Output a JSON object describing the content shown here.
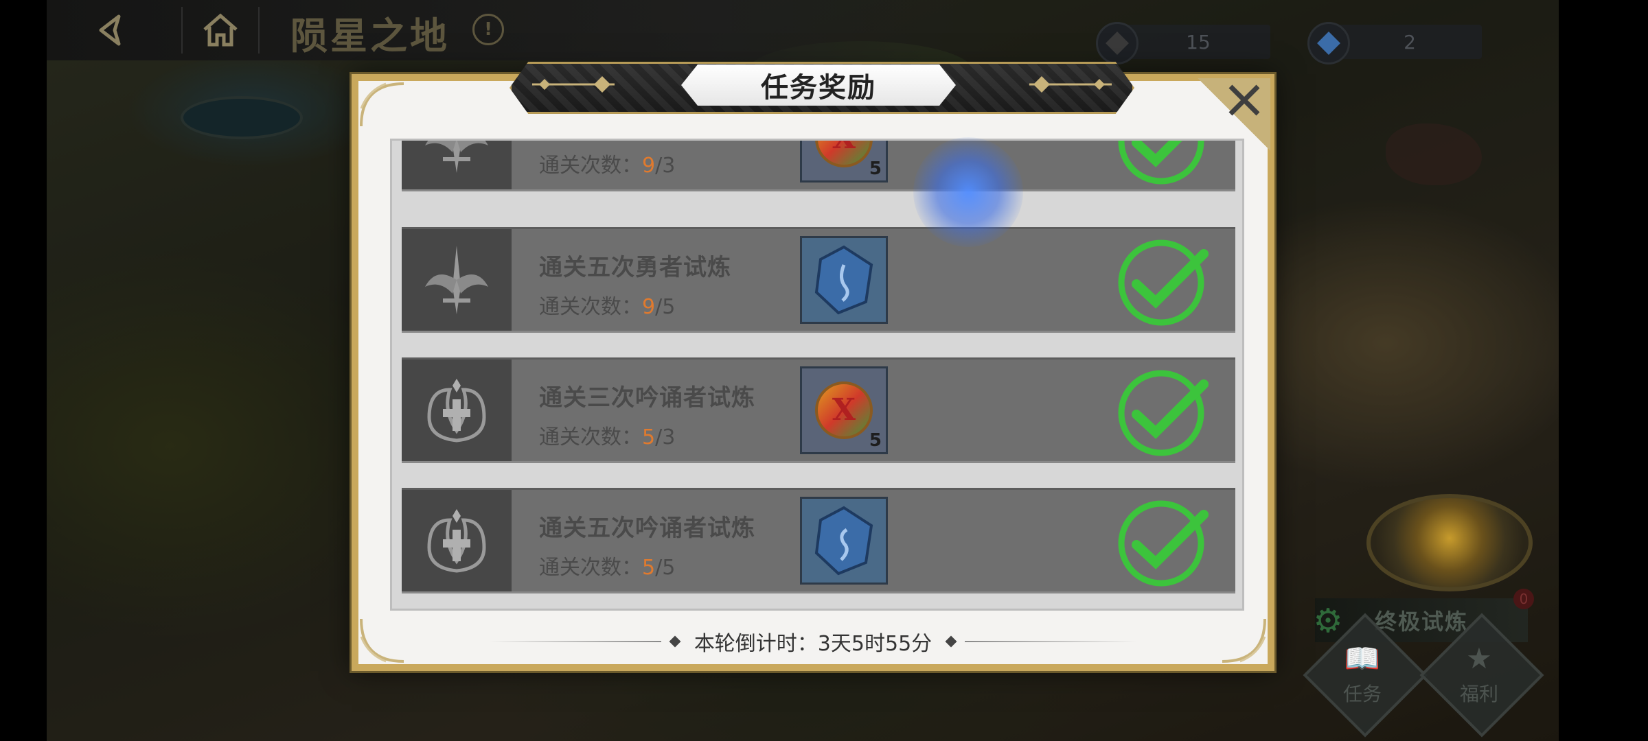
{
  "topbar": {
    "title": "陨星之地",
    "back_icon": "back-arrow-icon",
    "home_icon": "home-icon",
    "info_icon": "info-icon"
  },
  "currencies": [
    {
      "icon": "dark-gem-icon",
      "value": "15",
      "color": "#3a3a3a"
    },
    {
      "icon": "blue-gem-icon",
      "value": "2",
      "color": "#3b6ca8"
    }
  ],
  "hud": {
    "trial_label": "终极试炼",
    "trial_badge": "0",
    "task_button": "任务",
    "welfare_button": "福利"
  },
  "modal": {
    "title": "任务奖励",
    "close_icon": "close-icon",
    "countdown_label": "本轮倒计时：3天5时55分",
    "tasks": [
      {
        "name": "",
        "progress_label": "通关次数：",
        "current": "9",
        "total": "/3",
        "emblem": "winged-sword-emblem-icon",
        "reward": "rainbow-x-coin-icon",
        "reward_qty": "5",
        "completed": true
      },
      {
        "name": "通关五次勇者试炼",
        "progress_label": "通关次数：",
        "current": "9",
        "total": "/5",
        "emblem": "winged-sword-emblem-icon",
        "reward": "blue-rune-crystal-icon",
        "reward_qty": "",
        "completed": true
      },
      {
        "name": "通关三次吟诵者试炼",
        "progress_label": "通关次数：",
        "current": "5",
        "total": "/3",
        "emblem": "cross-flower-emblem-icon",
        "reward": "rainbow-x-coin-icon",
        "reward_qty": "5",
        "completed": true
      },
      {
        "name": "通关五次吟诵者试炼",
        "progress_label": "通关次数：",
        "current": "5",
        "total": "/5",
        "emblem": "cross-flower-emblem-icon",
        "reward": "blue-rune-crystal-icon",
        "reward_qty": "",
        "completed": true
      }
    ]
  },
  "colors": {
    "accent_gold": "#c9a85c",
    "progress_orange": "#e07a2e",
    "check_green": "#3cc43c"
  }
}
